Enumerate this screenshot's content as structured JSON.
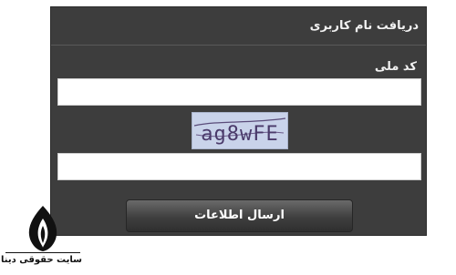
{
  "form": {
    "title": "دریافت نام کاربری",
    "national_code_label": "کد ملی",
    "national_code_value": "",
    "captcha_text": "ag8wFE",
    "captcha_value": "",
    "submit_label": "ارسال اطلاعات"
  },
  "logo": {
    "text": "سایت حقوقی دینا"
  },
  "colors": {
    "panel": "#3d3d3d",
    "captcha_background": "#c9d3ea",
    "captcha_text": "#4a3a6a"
  }
}
